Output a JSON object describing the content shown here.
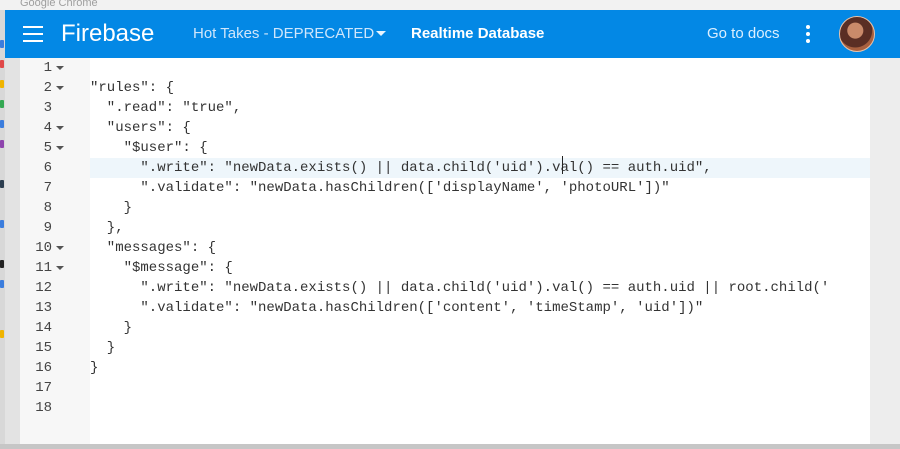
{
  "window": {
    "title": "Google Chrome"
  },
  "header": {
    "brand": "Firebase",
    "project": "Hot Takes - DEPRECATED",
    "section": "Realtime Database",
    "docs_link": "Go to docs",
    "icons": [
      "menu-icon",
      "chevron-down-icon",
      "more-vert-icon",
      "avatar"
    ]
  },
  "colors": {
    "header": "#0388e5",
    "active_line": "#eef6fb"
  },
  "editor": {
    "active_line": 6,
    "lines": [
      {
        "num": "1",
        "fold": true,
        "code": ""
      },
      {
        "num": "2",
        "fold": true,
        "code": "\"rules\": {"
      },
      {
        "num": "3",
        "fold": false,
        "code": "  \".read\": \"true\","
      },
      {
        "num": "4",
        "fold": true,
        "code": "  \"users\": {"
      },
      {
        "num": "5",
        "fold": true,
        "code": "    \"$user\": {"
      },
      {
        "num": "6",
        "fold": false,
        "code": "      \".write\": \"newData.exists() || data.child('uid').val() == auth.uid\","
      },
      {
        "num": "7",
        "fold": false,
        "code": "      \".validate\": \"newData.hasChildren(['displayName', 'photoURL'])\""
      },
      {
        "num": "8",
        "fold": false,
        "code": "    }"
      },
      {
        "num": "9",
        "fold": false,
        "code": "  },"
      },
      {
        "num": "10",
        "fold": true,
        "code": "  \"messages\": {"
      },
      {
        "num": "11",
        "fold": true,
        "code": "    \"$message\": {"
      },
      {
        "num": "12",
        "fold": false,
        "code": "      \".write\": \"newData.exists() || data.child('uid').val() == auth.uid || root.child('"
      },
      {
        "num": "13",
        "fold": false,
        "code": "      \".validate\": \"newData.hasChildren(['content', 'timeStamp', 'uid'])\""
      },
      {
        "num": "14",
        "fold": false,
        "code": "    }"
      },
      {
        "num": "15",
        "fold": false,
        "code": "  }"
      },
      {
        "num": "16",
        "fold": false,
        "code": "}"
      },
      {
        "num": "17",
        "fold": false,
        "code": ""
      },
      {
        "num": "18",
        "fold": false,
        "code": ""
      }
    ]
  }
}
